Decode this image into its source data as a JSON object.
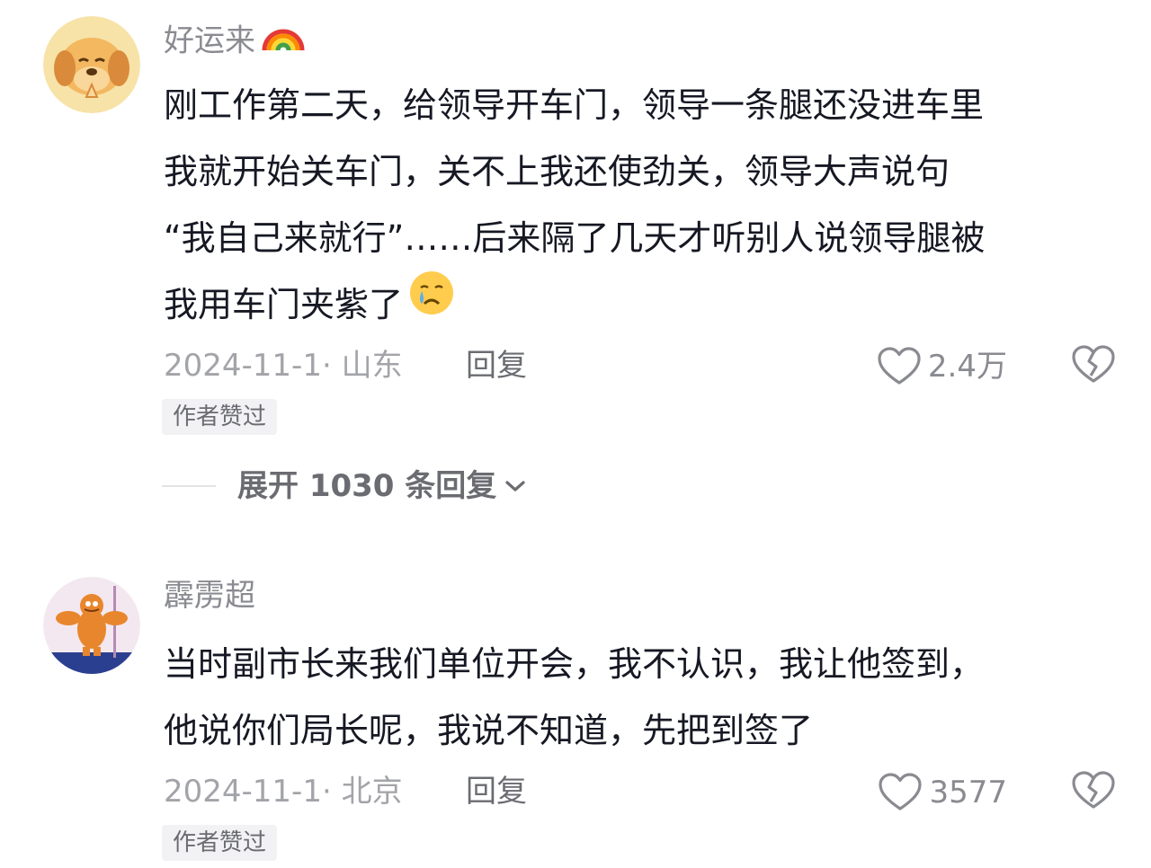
{
  "comments": [
    {
      "username": "好运来",
      "username_emoji": "rainbow-emoji",
      "avatar": "cartoon-dog-avatar",
      "lines": [
        "刚工作第二天，给领导开车门，领导一条腿还没进车里",
        "我就开始关车门，关不上我还使劲关，领导大声说句",
        "“我自己来就行”……后来隔了几天才听别人说领导腿被",
        "我用车门夹紫了"
      ],
      "trailing_emoji": "crying-face-emoji",
      "date_location": "2024-11-1· 山东",
      "reply_label": "回复",
      "likes": "2.4万",
      "badge": "作者赞过",
      "expand_label": "展开 1030 条回复"
    },
    {
      "username": "霹雳超",
      "avatar": "cartoon-cat-avatar",
      "lines": [
        "当时副市长来我们单位开会，我不认识，我让他签到，",
        "他说你们局长呢，我说不知道，先把到签了"
      ],
      "date_location": "2024-11-1· 北京",
      "reply_label": "回复",
      "likes": "3577",
      "badge": "作者赞过"
    }
  ],
  "colors": {
    "text_primary": "#161823",
    "text_secondary": "#8a8b91",
    "badge_bg": "#f2f2f4"
  }
}
